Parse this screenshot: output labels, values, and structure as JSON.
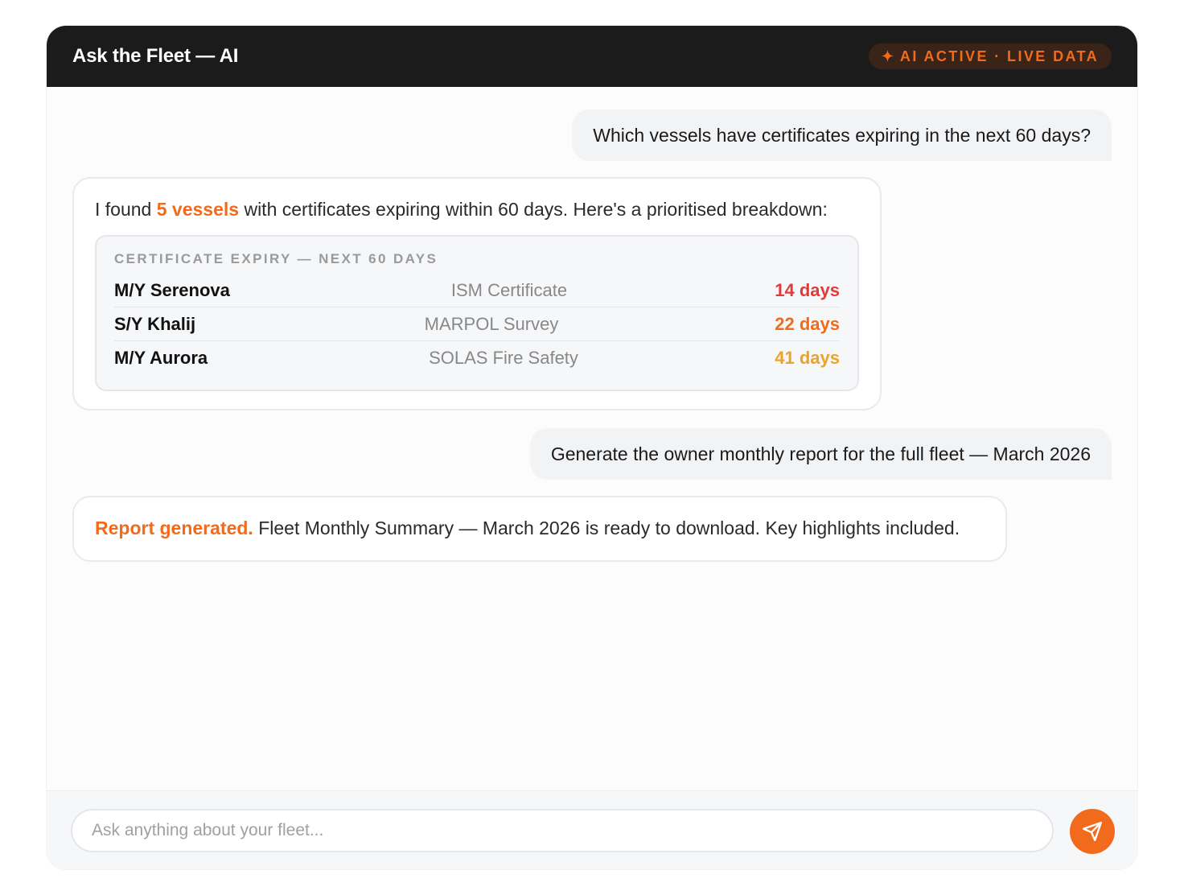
{
  "header": {
    "title": "Ask the Fleet — AI",
    "badge_icon": "✦",
    "badge_text": "AI ACTIVE · LIVE DATA"
  },
  "messages": [
    {
      "role": "user",
      "text": "Which vessels have certificates expiring in the next 60 days?"
    },
    {
      "role": "ai",
      "text_before": "I found ",
      "highlight": "5 vessels",
      "text_after": " with certificates expiring within 60 days. Here's a prioritised breakdown:",
      "card": {
        "title": "CERTIFICATE EXPIRY — NEXT 60 DAYS",
        "rows": [
          {
            "vessel": "M/Y Serenova",
            "certificate": "ISM Certificate",
            "days": "14 days",
            "color": "#e03b3b"
          },
          {
            "vessel": "S/Y Khalij",
            "certificate": "MARPOL Survey",
            "days": "22 days",
            "color": "#f26a1b"
          },
          {
            "vessel": "M/Y Aurora",
            "certificate": "SOLAS Fire Safety",
            "days": "41 days",
            "color": "#eba32a"
          }
        ]
      }
    },
    {
      "role": "user",
      "text": "Generate the owner monthly report for the full fleet — March 2026"
    },
    {
      "role": "ai",
      "highlight": "Report generated.",
      "text_after": " Fleet Monthly Summary — March 2026 is ready to download. Key highlights included."
    }
  ],
  "composer": {
    "placeholder": "Ask anything about your fleet...",
    "value": "",
    "send_icon": "send-icon"
  },
  "colors": {
    "accent": "#f26a1b",
    "header_bg": "#1b1b1b",
    "urgent": "#e03b3b",
    "warning": "#f26a1b",
    "caution": "#eba32a"
  }
}
